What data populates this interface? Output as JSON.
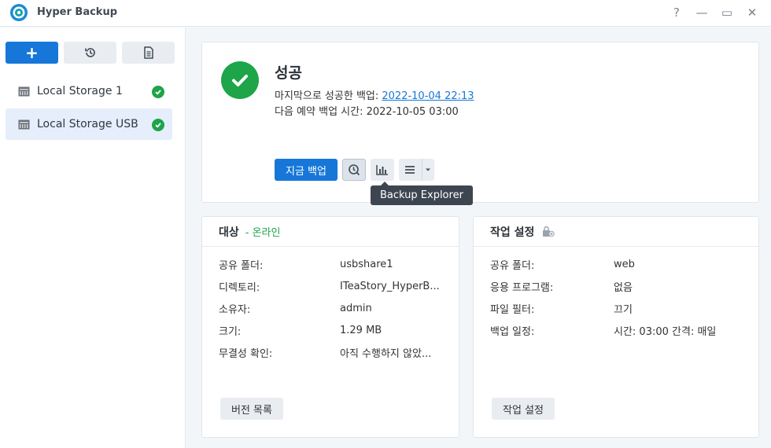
{
  "app": {
    "title": "Hyper Backup"
  },
  "window_controls": {
    "help": "?",
    "minimize": "—",
    "maximize": "▭",
    "close": "✕"
  },
  "sidebar": {
    "add_label": "+",
    "items": [
      {
        "label": "Local Storage 1",
        "status": "success"
      },
      {
        "label": "Local Storage USB",
        "status": "success",
        "selected": true
      }
    ]
  },
  "status": {
    "title": "성공",
    "last_backup_label": "마지막으로 성공한 백업:",
    "last_backup_value": "2022-10-04 22:13",
    "next_backup_label": "다음 예약 백업 시간:",
    "next_backup_value": "2022-10-05 03:00",
    "backup_now_label": "지금 백업",
    "tooltip": "Backup Explorer"
  },
  "target": {
    "title": "대상",
    "status": "- 온라인",
    "rows": [
      {
        "key": "공유 폴더:",
        "value": "usbshare1"
      },
      {
        "key": "디렉토리:",
        "value": "ITeaStory_HyperB..."
      },
      {
        "key": "소유자:",
        "value": "admin"
      },
      {
        "key": "크기:",
        "value": "1.29 MB"
      },
      {
        "key": "무결성 확인:",
        "value": "아직 수행하지 않았..."
      }
    ],
    "button_label": "버전 목록"
  },
  "settings": {
    "title": "작업 설정",
    "rows": [
      {
        "key": "공유 폴더:",
        "value": "web"
      },
      {
        "key": "응용 프로그램:",
        "value": "없음"
      },
      {
        "key": "파일 필터:",
        "value": "끄기"
      },
      {
        "key": "백업 일정:",
        "value": "시간: 03:00 간격: 매일"
      }
    ],
    "button_label": "작업 설정"
  },
  "colors": {
    "accent": "#1677d9",
    "success": "#1ea449",
    "tooltip_bg": "#3d4650"
  }
}
